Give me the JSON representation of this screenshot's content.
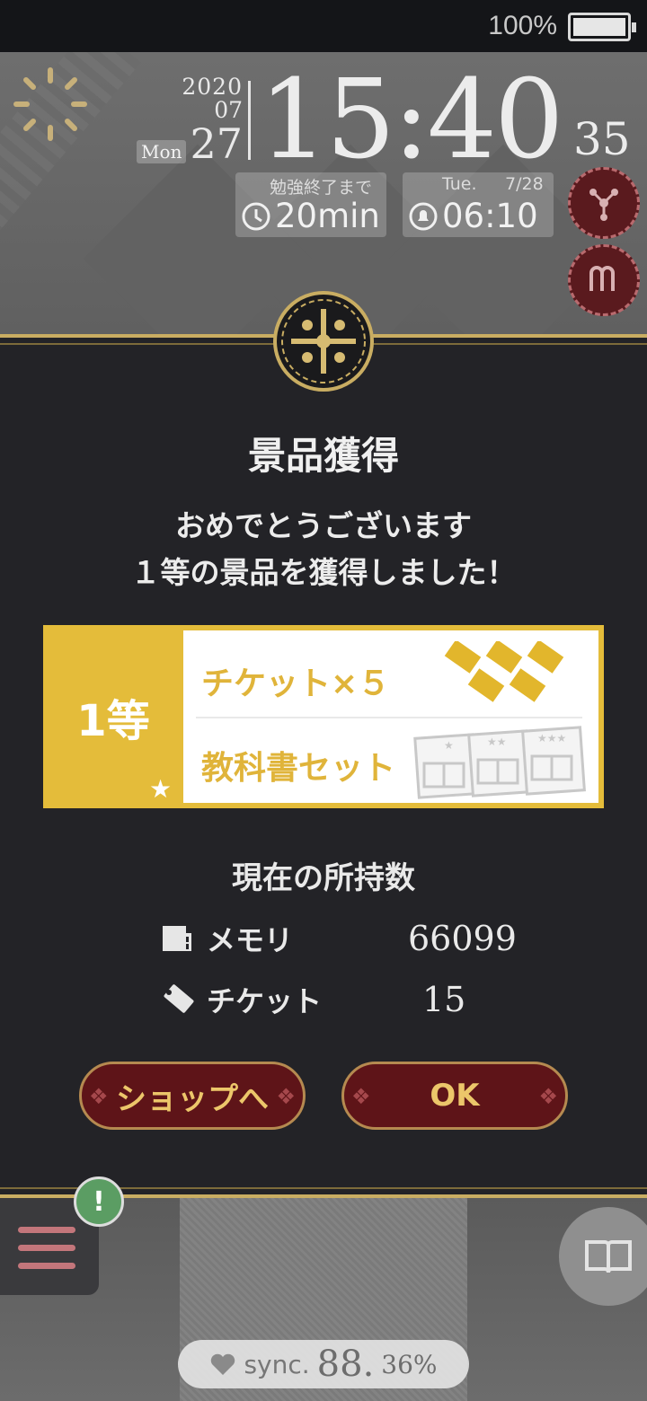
{
  "status_bar": {
    "battery_percent": "100%"
  },
  "clock": {
    "year": "2020",
    "month": "07",
    "day_of_week": "Mon",
    "day": "27",
    "time": "15:40",
    "seconds": "35"
  },
  "study_timer": {
    "label": "勉強終了まで",
    "value": "20min"
  },
  "alarm": {
    "day": "Tue.",
    "date": "7/28",
    "time": "06:10"
  },
  "dialog": {
    "title": "景品獲得",
    "message_line1": "おめでとうございます",
    "message_line2": "１等の景品を獲得しました！",
    "prize": {
      "rank": "1等",
      "item1": "チケット×５",
      "item2": "教科書セット"
    },
    "holdings_title": "現在の所持数",
    "holdings": [
      {
        "label": "メモリ",
        "value": "66099",
        "icon": "memory-card-icon"
      },
      {
        "label": "チケット",
        "value": "15",
        "icon": "ticket-icon"
      }
    ],
    "shop_button": "ショップへ",
    "ok_button": "OK"
  },
  "sync": {
    "label": "sync.",
    "value_int": "88.",
    "value_dec": "36%"
  },
  "colors": {
    "gold": "#e4bc3a",
    "button_bg": "#5e1418",
    "button_text": "#ecc66a",
    "panel_bg": "#232327"
  }
}
